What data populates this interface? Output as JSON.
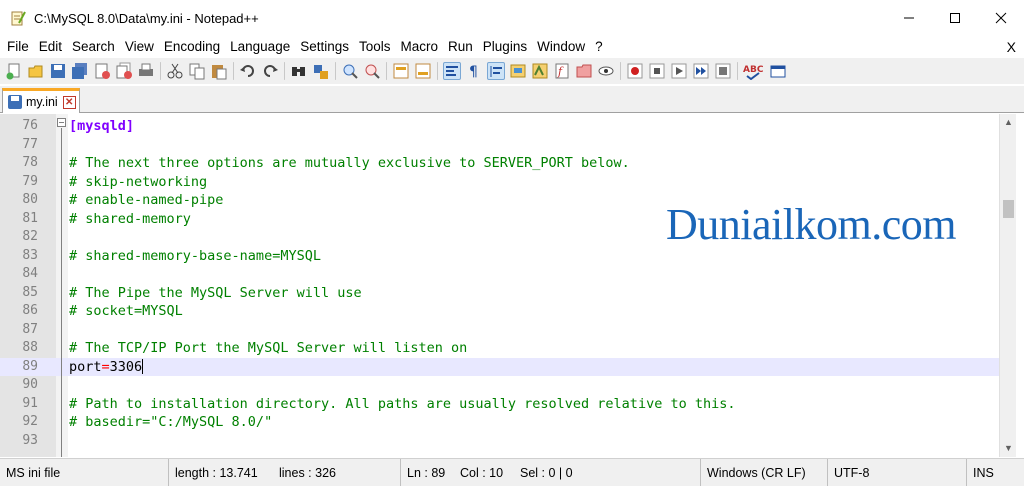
{
  "window": {
    "title": "C:\\MySQL 8.0\\Data\\my.ini - Notepad++",
    "minimize": "—",
    "maximize": "☐",
    "close": "✕"
  },
  "menu": {
    "items": [
      "File",
      "Edit",
      "Search",
      "View",
      "Encoding",
      "Language",
      "Settings",
      "Tools",
      "Macro",
      "Run",
      "Plugins",
      "Window",
      "?"
    ],
    "close_label": "X"
  },
  "tab": {
    "name": "my.ini",
    "close": "✕"
  },
  "editor": {
    "lines": [
      {
        "n": "76",
        "parts": [
          {
            "t": "[mysqld]",
            "c": "section"
          }
        ]
      },
      {
        "n": "77",
        "parts": []
      },
      {
        "n": "78",
        "parts": [
          {
            "t": "# The next three options are mutually exclusive to SERVER_PORT below.",
            "c": "comment"
          }
        ]
      },
      {
        "n": "79",
        "parts": [
          {
            "t": "# skip-networking",
            "c": "comment"
          }
        ]
      },
      {
        "n": "80",
        "parts": [
          {
            "t": "# enable-named-pipe",
            "c": "comment"
          }
        ]
      },
      {
        "n": "81",
        "parts": [
          {
            "t": "# shared-memory",
            "c": "comment"
          }
        ]
      },
      {
        "n": "82",
        "parts": []
      },
      {
        "n": "83",
        "parts": [
          {
            "t": "# shared-memory-base-name=MYSQL",
            "c": "comment"
          }
        ]
      },
      {
        "n": "84",
        "parts": []
      },
      {
        "n": "85",
        "parts": [
          {
            "t": "# The Pipe the MySQL Server will use",
            "c": "comment"
          }
        ]
      },
      {
        "n": "86",
        "parts": [
          {
            "t": "# socket=MYSQL",
            "c": "comment"
          }
        ]
      },
      {
        "n": "87",
        "parts": []
      },
      {
        "n": "88",
        "parts": [
          {
            "t": "# The TCP/IP Port the MySQL Server will listen on",
            "c": "comment"
          }
        ]
      },
      {
        "n": "89",
        "parts": [
          {
            "t": "port",
            "c": "key"
          },
          {
            "t": "=",
            "c": "eq"
          },
          {
            "t": "3306",
            "c": "val"
          }
        ],
        "current": true
      },
      {
        "n": "90",
        "parts": []
      },
      {
        "n": "91",
        "parts": [
          {
            "t": "# Path to installation directory. All paths are usually resolved relative to this.",
            "c": "comment"
          }
        ]
      },
      {
        "n": "92",
        "parts": [
          {
            "t": "# basedir=\"C:/MySQL 8.0/\"",
            "c": "comment"
          }
        ]
      },
      {
        "n": "93",
        "parts": []
      }
    ],
    "watermark": "Duniailkom.com"
  },
  "status": {
    "file_type": "MS ini file",
    "length": "length : 13.741",
    "lines": "lines : 326",
    "ln": "Ln : 89",
    "col": "Col : 10",
    "sel": "Sel : 0 | 0",
    "eol": "Windows (CR LF)",
    "encoding": "UTF-8",
    "mode": "INS"
  },
  "toolbar_icons": [
    "new-file-icon",
    "open-file-icon",
    "save-icon",
    "save-all-icon",
    "close-icon",
    "close-all-icon",
    "print-icon",
    "cut-icon",
    "copy-icon",
    "paste-icon",
    "undo-icon",
    "redo-icon",
    "find-icon",
    "replace-icon",
    "zoom-in-icon",
    "zoom-out-icon",
    "sync-v-icon",
    "sync-h-icon",
    "wrap-icon",
    "all-chars-icon",
    "indent-guide-icon",
    "udl-icon",
    "doc-map-icon",
    "function-list-icon",
    "folder-workspace-icon",
    "monitor-icon",
    "record-macro-icon",
    "stop-macro-icon",
    "play-macro-icon",
    "run-macro-multiple-icon",
    "save-macro-icon",
    "spellcheck-icon",
    "panel-icon"
  ]
}
